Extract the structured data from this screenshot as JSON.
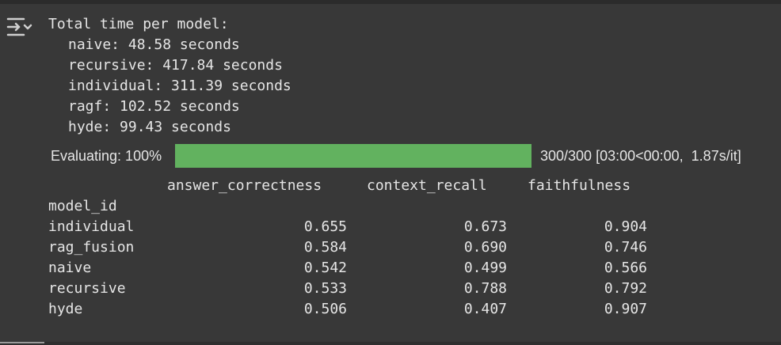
{
  "stdout": {
    "title": "Total time per model:",
    "lines": [
      "naive: 48.58 seconds",
      "recursive: 417.84 seconds",
      "individual: 311.39 seconds",
      "ragf: 102.52 seconds",
      "hyde: 99.43 seconds"
    ]
  },
  "progress": {
    "label": "Evaluating: 100%",
    "fraction": 1.0,
    "status": "300/300 [03:00<00:00,  1.87s/it]",
    "fill_color": "#62b25f"
  },
  "table": {
    "columns": [
      "answer_correctness",
      "context_recall",
      "faithfulness"
    ],
    "index_name": "model_id",
    "rows": [
      {
        "model": "individual",
        "values": [
          "0.655",
          "0.673",
          "0.904"
        ]
      },
      {
        "model": "rag_fusion",
        "values": [
          "0.584",
          "0.690",
          "0.746"
        ]
      },
      {
        "model": "naive",
        "values": [
          "0.542",
          "0.499",
          "0.566"
        ]
      },
      {
        "model": "recursive",
        "values": [
          "0.533",
          "0.788",
          "0.792"
        ]
      },
      {
        "model": "hyde",
        "values": [
          "0.506",
          "0.407",
          "0.907"
        ]
      }
    ]
  },
  "icons": {
    "output_toggle": "output-toggle-icon"
  }
}
